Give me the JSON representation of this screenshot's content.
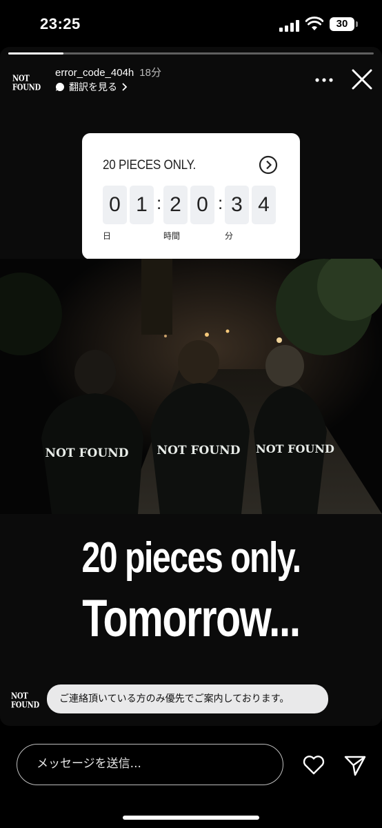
{
  "status_bar": {
    "time": "23:25",
    "battery": "30"
  },
  "story": {
    "progress": 0.15,
    "username": "error_code_404h",
    "time_ago": "18分",
    "translate_label": "翻訳を見る",
    "avatar_logo": "NOT FOUND"
  },
  "countdown": {
    "title": "20 PIECES ONLY.",
    "digits": [
      "0",
      "1",
      "2",
      "0",
      "3",
      "4"
    ],
    "units": {
      "days": "日",
      "hours": "時間",
      "minutes": "分"
    }
  },
  "headline": {
    "line1": "20 pieces only.",
    "line2": "Tomorrow..."
  },
  "shirt_text": "NOT FOUND",
  "reply": {
    "avatar_logo": "NOT FOUND",
    "text": "ご連絡頂いている方のみ優先でご案内しております。"
  },
  "composer": {
    "placeholder": "メッセージを送信..."
  },
  "colors": {
    "background": "#000000",
    "card": "#ffffff",
    "digit_bg": "#eef0f3",
    "bubble": "#e9e9ea"
  },
  "icons": [
    "signal-icon",
    "wifi-icon",
    "battery-icon",
    "translate-bubble-icon",
    "more-icon",
    "close-icon",
    "arrow-circle-icon",
    "heart-icon",
    "send-icon"
  ]
}
